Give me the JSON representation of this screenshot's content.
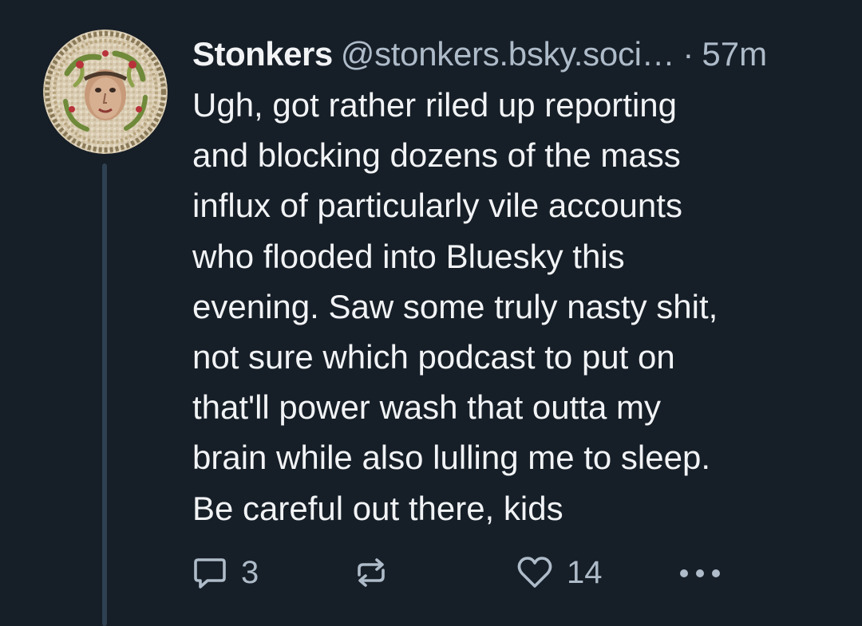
{
  "post": {
    "author": {
      "display_name": "Stonkers",
      "handle": "@stonkers.bsky.soci…",
      "avatar_icon": "mosaic-medusa-avatar"
    },
    "separator": "·",
    "timestamp": "57m",
    "text_lines": [
      "Ugh, got rather riled up reporting",
      "and blocking dozens of the mass",
      "influx of particularly vile accounts",
      "who flooded into Bluesky this",
      "evening. Saw some truly nasty shit,",
      "not sure which podcast to put on",
      "that'll power wash that outta my",
      "brain while also lulling me to sleep.",
      "Be careful out there, kids"
    ],
    "actions": {
      "reply": {
        "icon": "reply-icon",
        "count": "3"
      },
      "repost": {
        "icon": "repost-icon",
        "count": ""
      },
      "like": {
        "icon": "heart-icon",
        "count": "14"
      },
      "more": {
        "icon": "more-icon"
      }
    }
  },
  "colors": {
    "background": "#161e27",
    "text_primary": "#f1f3f5",
    "text_secondary": "#aebbc9",
    "thread_line": "#2e4052"
  }
}
